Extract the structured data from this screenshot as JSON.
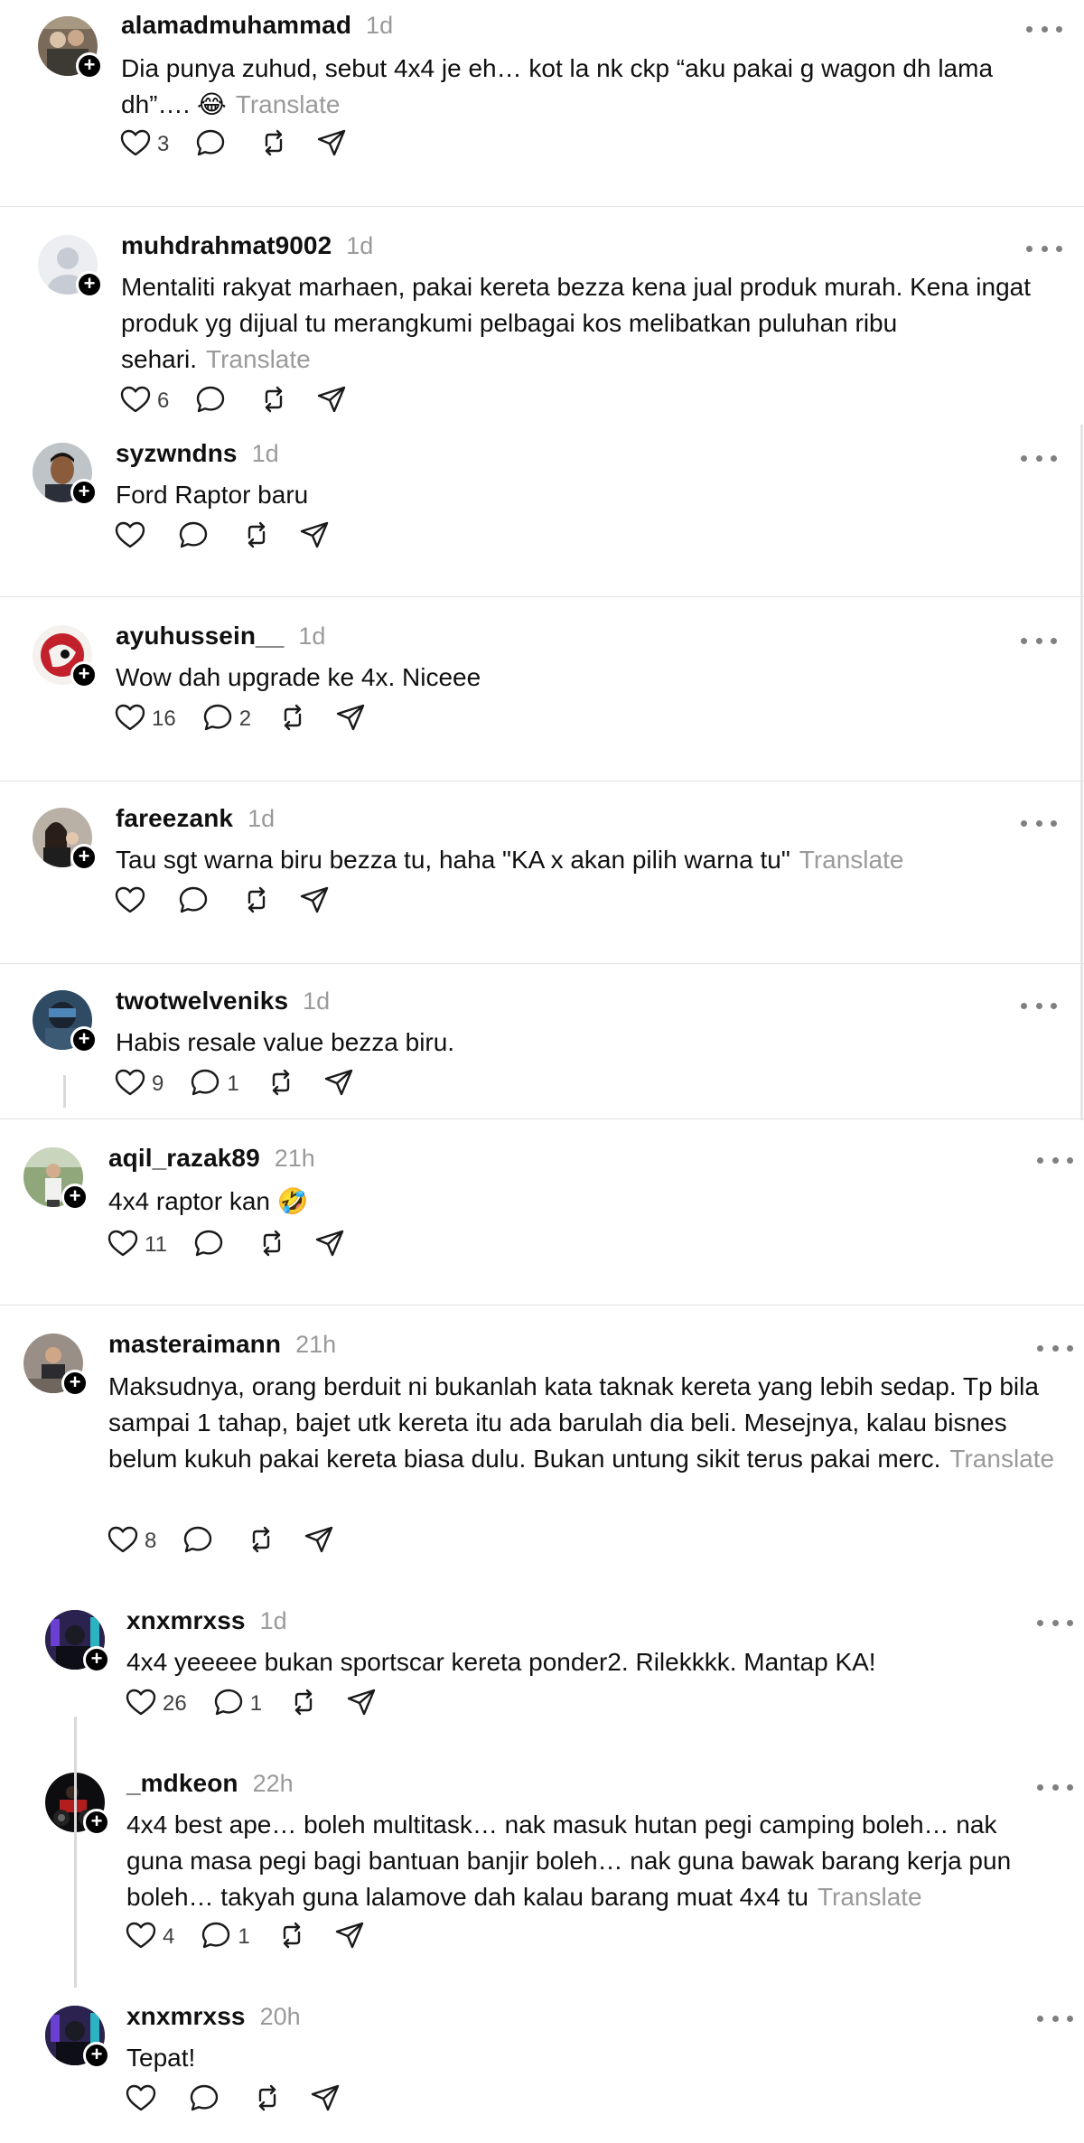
{
  "ui": {
    "translate": "Translate"
  },
  "posts": [
    {
      "user": "alamadmuhammad",
      "time": "1d",
      "text": "Dia punya zuhud, sebut 4x4 je eh… kot la nk ckp “aku pakai g wagon dh lama dh”…. 😂",
      "translate": true,
      "likes": "3",
      "replies": ""
    },
    {
      "user": "muhdrahmat9002",
      "time": "1d",
      "text": "Mentaliti rakyat marhaen, pakai kereta bezza kena jual produk murah. Kena ingat produk yg dijual tu merangkumi pelbagai kos melibatkan puluhan ribu sehari.",
      "translate": true,
      "likes": "6",
      "replies": ""
    },
    {
      "user": "syzwndns",
      "time": "1d",
      "text": "Ford Raptor baru",
      "translate": false,
      "likes": "",
      "replies": ""
    },
    {
      "user": "ayuhussein__",
      "time": "1d",
      "text": "Wow dah upgrade ke 4x. Niceee",
      "translate": false,
      "likes": "16",
      "replies": "2"
    },
    {
      "user": "fareezank",
      "time": "1d",
      "text": "Tau sgt warna biru bezza tu, haha \"KA x akan pilih warna tu\"",
      "translate": true,
      "likes": "",
      "replies": ""
    },
    {
      "user": "twotwelveniks",
      "time": "1d",
      "text": "Habis resale value bezza biru.",
      "translate": false,
      "likes": "9",
      "replies": "1"
    },
    {
      "user": "aqil_razak89",
      "time": "21h",
      "text": "4x4 raptor kan 🤣",
      "translate": false,
      "likes": "11",
      "replies": ""
    },
    {
      "user": "masteraimann",
      "time": "21h",
      "text": "Maksudnya, orang berduit ni bukanlah kata taknak kereta yang lebih sedap. Tp bila sampai 1 tahap, bajet utk kereta itu ada barulah dia beli. Mesejnya, kalau bisnes belum kukuh pakai kereta biasa dulu. Bukan untung sikit terus pakai merc.",
      "translate": true,
      "likes": "8",
      "replies": ""
    },
    {
      "user": "xnxmrxss",
      "time": "1d",
      "text": "4x4 yeeeee bukan sportscar kereta ponder2. Rilekkkk. Mantap KA!",
      "translate": false,
      "likes": "26",
      "replies": "1"
    },
    {
      "user": "_mdkeon",
      "time": "22h",
      "text": "4x4 best ape… boleh multitask… nak masuk hutan pegi camping boleh… nak guna masa pegi bagi bantuan banjir boleh… nak guna bawak barang kerja pun boleh… takyah guna lalamove dah kalau barang muat 4x4 tu",
      "translate": true,
      "likes": "4",
      "replies": "1"
    },
    {
      "user": "xnxmrxss",
      "time": "20h",
      "text": "Tepat!",
      "translate": false,
      "likes": "",
      "replies": ""
    }
  ]
}
